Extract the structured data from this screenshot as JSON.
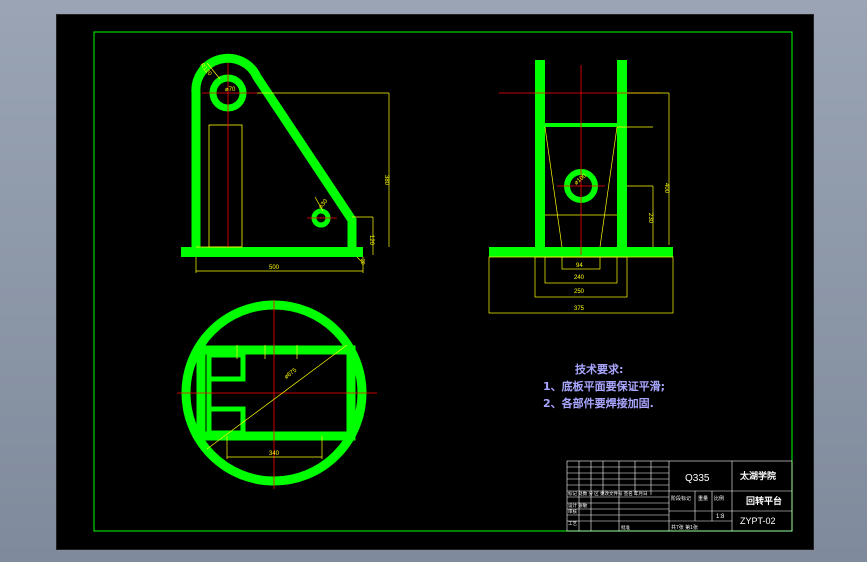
{
  "drawing": {
    "tech_requirements_title": "技术要求:",
    "tech_requirements": [
      "1、底板平面要保证平滑;",
      "2、各部件要焊接加固."
    ],
    "title_block": {
      "material": "Q335",
      "school": "太湖学院",
      "part_name": "回转平台",
      "drawing_no": "ZYPT-02",
      "scale_header": "比例",
      "scale": "1:8",
      "stage_headers": [
        "阶段标记",
        "重量",
        "比例"
      ],
      "sheets": "共7张  第1张",
      "rows_left": [
        "标记 处数 分 区 更改文件号 签名 年月日",
        "设计 张敏",
        "审核",
        "工艺",
        "批准"
      ]
    },
    "dimensions": {
      "front_radius": "R120",
      "front_hole": "⌀70",
      "front_height": "380",
      "front_small_hole": "⌀30",
      "front_base_width": "500",
      "front_base_height": "120",
      "front_base_thk": "20",
      "side_hole": "⌀100",
      "side_height": "400",
      "side_inner_height": "230",
      "side_d1": "94",
      "side_d2": "240",
      "side_d3": "250",
      "side_d4": "375",
      "top_diameter": "⌀675",
      "top_width": "340"
    }
  },
  "colors": {
    "background": "#000000",
    "part": "#00ff00",
    "dimension": "#ffff00",
    "centerline": "#ff0000",
    "border": "#00ff00",
    "notes": "#a9a6ff",
    "desktop": "#8a94a6"
  }
}
